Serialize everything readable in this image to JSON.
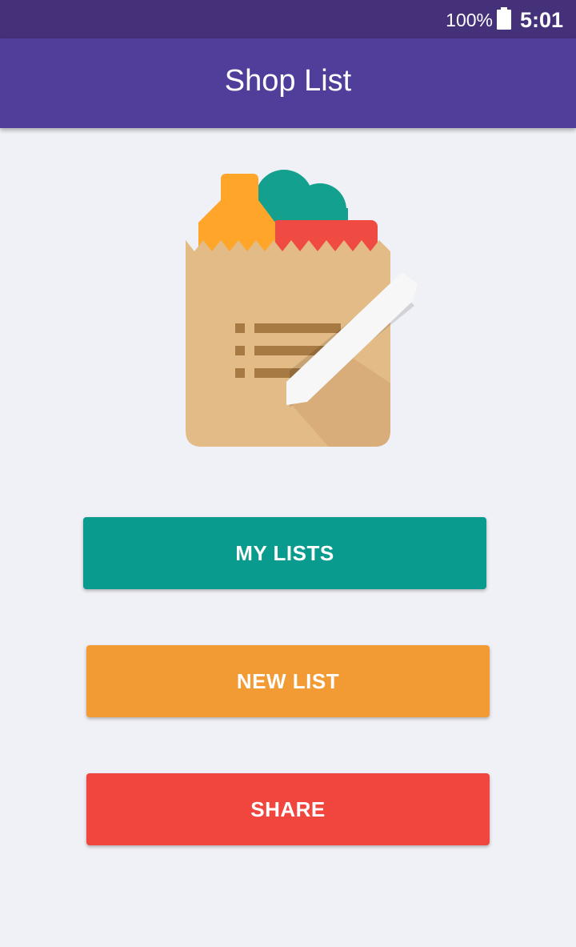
{
  "status_bar": {
    "battery_percent": "100%",
    "time": "5:01",
    "battery_icon": "battery-full-icon"
  },
  "app_bar": {
    "title": "Shop List"
  },
  "logo": {
    "icon": "shopping-bag-list-pencil-icon"
  },
  "actions": {
    "my_lists": "MY LISTS",
    "new_list": "NEW LIST",
    "share": "SHARE"
  },
  "colors": {
    "status_bar": "#45307a",
    "app_bar": "#503e9a",
    "background": "#f0f1f6",
    "my_lists": "#0a9b8f",
    "new_list": "#f29a33",
    "share": "#f0463d"
  }
}
